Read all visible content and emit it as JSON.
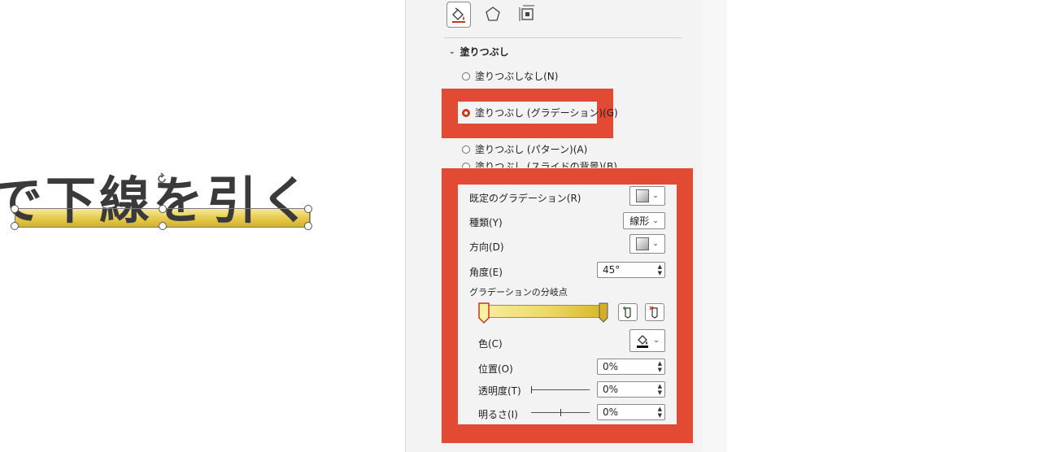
{
  "slide": {
    "text": "で下線を引く"
  },
  "tabs": [
    {
      "icon": "fill-line-icon"
    },
    {
      "icon": "effects-icon"
    },
    {
      "icon": "size-properties-icon"
    }
  ],
  "fill_section": {
    "title": "塗りつぶし",
    "options": {
      "none": "塗りつぶしなし(N)",
      "gradient": "塗りつぶし (グラデーション)(G)",
      "pattern": "塗りつぶし (パターン)(A)",
      "background": "塗りつぶし (スライドの背景)(B)"
    },
    "selected": "gradient"
  },
  "gradient": {
    "preset_label": "既定のグラデーション(R)",
    "type_label": "種類(Y)",
    "type_value": "線形",
    "direction_label": "方向(D)",
    "angle_label": "角度(E)",
    "angle_value": "45°",
    "stops_label": "グラデーションの分岐点",
    "color_label": "色(C)",
    "position_label": "位置(O)",
    "position_value": "0%",
    "transparency_label": "透明度(T)",
    "transparency_value": "0%",
    "brightness_label": "明るさ(I)",
    "brightness_value": "0%"
  },
  "colors": {
    "highlight": "#e34a33",
    "radio_selected": "#c8371a",
    "gradient_start": "#f7ed9e",
    "gradient_end": "#d9b52a"
  }
}
